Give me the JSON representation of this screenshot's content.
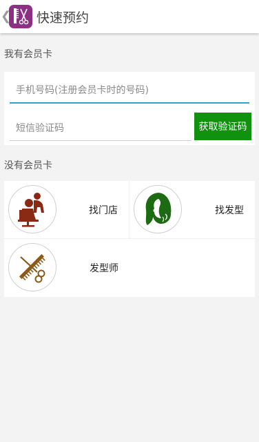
{
  "header": {
    "title": "快速预约",
    "back_icon": "chevron-left-icon",
    "app_icon": "comb-scissors-icon",
    "app_icon_color": "#8e2f86"
  },
  "member_section": {
    "label": "我有会员卡",
    "phone_placeholder": "手机号码(注册会员卡时的号码)",
    "sms_placeholder": "短信验证码",
    "sms_button_label": "获取验证码",
    "button_color": "#10920f",
    "focus_color": "#2aa7c8"
  },
  "non_member_section": {
    "label": "没有会员卡",
    "items": [
      {
        "label": "找门店",
        "icon": "salon-chair-icon",
        "icon_color": "#8b2a14"
      },
      {
        "label": "找发型",
        "icon": "hairstyle-woman-icon",
        "icon_color": "#1c6b12"
      },
      {
        "label": "发型师",
        "icon": "comb-scissors-icon",
        "icon_color": "#8a5a1a"
      }
    ]
  }
}
